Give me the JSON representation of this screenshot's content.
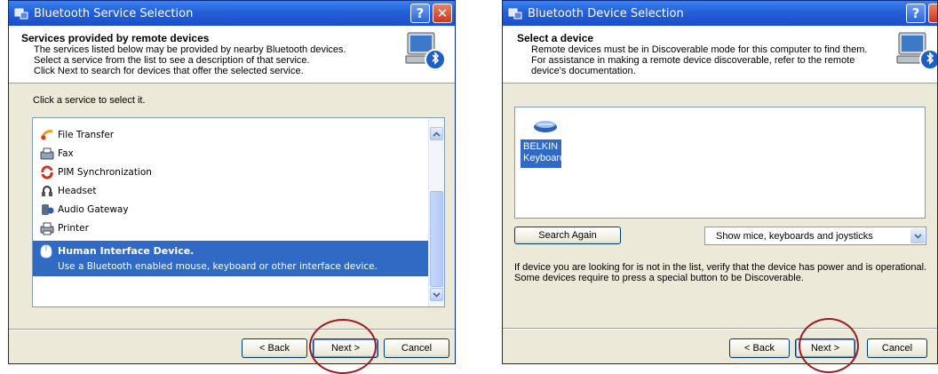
{
  "window1": {
    "title": "Bluetooth Service Selection",
    "header_title": "Services provided by remote devices",
    "header_lines": [
      "The services listed below may be provided by nearby Bluetooth devices.",
      "Select a service from the list to see a description of that service.",
      "Click Next to search for devices that offer the selected service."
    ],
    "instruction": "Click a service to select it.",
    "services": [
      {
        "label": "File Transfer",
        "icon": "file-transfer-icon"
      },
      {
        "label": "Fax",
        "icon": "fax-icon"
      },
      {
        "label": "PIM Synchronization",
        "icon": "pim-sync-icon"
      },
      {
        "label": "Headset",
        "icon": "headset-icon"
      },
      {
        "label": "Audio Gateway",
        "icon": "audio-gateway-icon"
      },
      {
        "label": "Printer",
        "icon": "printer-icon"
      }
    ],
    "selected_service": {
      "label": "Human Interface Device.",
      "description": "Use a Bluetooth enabled mouse, keyboard or other interface device.",
      "icon": "mouse-icon"
    },
    "buttons": {
      "back": "< Back",
      "next": "Next >",
      "cancel": "Cancel"
    }
  },
  "window2": {
    "title": "Bluetooth Device Selection",
    "header_title": "Select a device",
    "header_lines": [
      "Remote devices must be in Discoverable mode for this computer to find them.",
      "For assistance in making a remote device discoverable, refer to the remote",
      "device's documentation."
    ],
    "device": {
      "name_line1": "BELKIN",
      "name_line2": "Keyboard",
      "icon": "keyboard-icon"
    },
    "search_again": "Search Again",
    "filter_value": "Show mice, keyboards and joysticks",
    "info_lines": [
      "If device you are looking for is not in the list, verify that the device has power and is operational.",
      "Some devices require to press a special button to be Discoverable."
    ],
    "buttons": {
      "back": "< Back",
      "next": "Next >",
      "cancel": "Cancel"
    }
  },
  "colors": {
    "title_bar": "#2460d8",
    "selection": "#316ac5",
    "highlight_circle": "#9b1b22"
  }
}
